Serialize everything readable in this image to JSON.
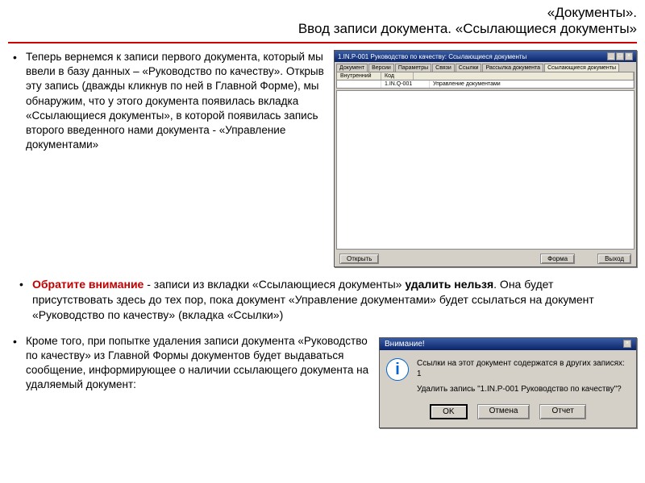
{
  "header": {
    "line1": "«Документы».",
    "line2": "Ввод записи документа. «Ссылающиеся документы»"
  },
  "bullets": {
    "first": "Теперь вернемся к записи первого документа, который мы ввели в базу данных – «Руководство по качеству». Открыв эту запись (дважды кликнув по ней в Главной Форме), мы обнаружим, что у этого документа появилась вкладка «Ссылающиеся документы», в которой появилась запись второго введенного нами документа  - «Управление документами»",
    "third": "Кроме того, при попытке удаления записи документа «Руководство по качеству» из Главной Формы документов будет выдаваться сообщение, информирующее о наличии ссылающего документа на удаляемый документ:"
  },
  "note": {
    "lead": "Обратите внимание",
    "mid": " -  записи из вкладки «Ссылающиеся документы» ",
    "strong": "удалить нельзя",
    "tail": ". Она будет присутствовать здесь до тех пор, пока документ «Управление документами» будет ссылаться на документ «Руководство по качеству» (вкладка «Ссылки»)"
  },
  "app": {
    "title": "1.IN.P-001 Руководство по качеству: Ссылающиеся документы",
    "tabs": [
      "Документ",
      "Версии",
      "Параметры",
      "Связи",
      "Ссылки",
      "Рассылка документа",
      "Ссылающиеся документы"
    ],
    "columns": {
      "c1": "Внутренний",
      "c2": "Код",
      "c3": "1.IN.Q-001",
      "c4": "Управление документами"
    },
    "buttons": {
      "open": "Открыть",
      "form": "Форма",
      "exit": "Выход"
    }
  },
  "dialog": {
    "title": "Внимание!",
    "line1": "Ссылки на этот документ содержатся в других записях: 1",
    "line2": "Удалить запись \"1.IN.P-001 Руководство по качеству\"?",
    "ok": "OK",
    "cancel": "Отмена",
    "report": "Отчет",
    "close": "×",
    "icon": "i"
  }
}
